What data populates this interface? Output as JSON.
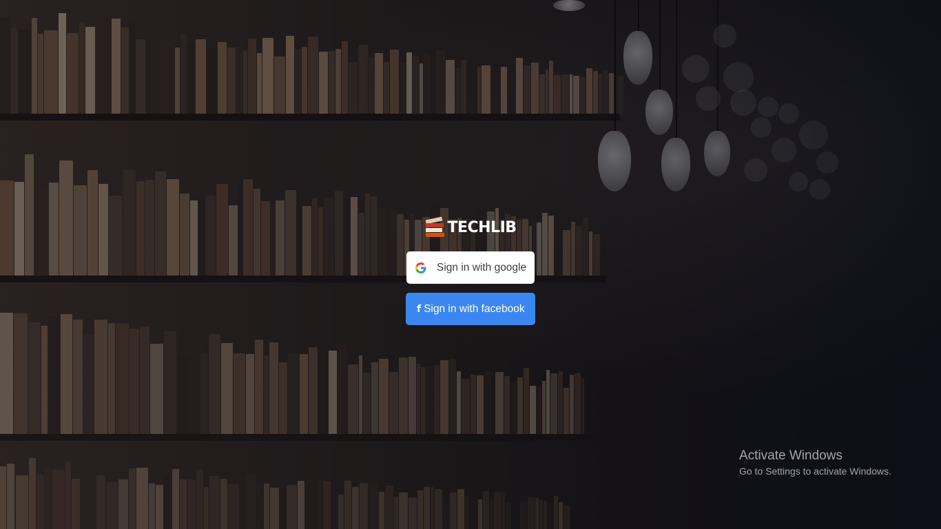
{
  "brand": {
    "logo_text": "TECHLIB",
    "logo_icon": "books-stack-icon"
  },
  "auth": {
    "google_label": "Sign in with google",
    "google_icon": "google-g-icon",
    "facebook_label": "Sign in with facebook",
    "facebook_icon": "facebook-f-icon"
  },
  "colors": {
    "facebook_button": "#3b87f2",
    "google_button": "#ffffff"
  },
  "watermark": {
    "title": "Activate Windows",
    "subtitle": "Go to Settings to activate Windows."
  }
}
